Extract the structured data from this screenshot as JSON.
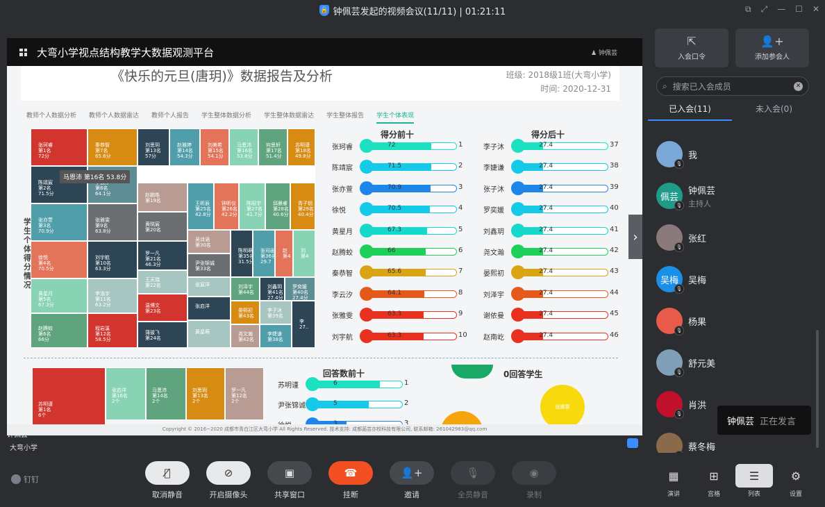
{
  "window": {
    "title": "钟佩芸发起的视频会议(11/11) | 01:21:11"
  },
  "share": {
    "platform_title": "大弯小学视点结构教学大数据观测平台",
    "user": "钟佩芸",
    "report_title": "《快乐的元旦(唐玥)》数据报告及分析",
    "class_info": "班级: 2018级1班(大弯小学)",
    "time_info": "时间: 2020-12-31",
    "tabs": [
      "教师个人数据分析",
      "教师个人数据雷达",
      "教师个人报告",
      "学生整体数据分析",
      "学生整体数据雷达",
      "学生整体报告",
      "学生个体表现"
    ],
    "vertical_label": "学生个体得分情况",
    "tooltip": "马恩沛 第16名 53.8分",
    "treemap_cells": [
      {
        "text": "张珂睿\n第1名\n72分",
        "color": "#d2352e"
      },
      {
        "text": "秦恭智\n第7名\n65.6分",
        "color": "#d78b12"
      },
      {
        "text": "刘思玥\n第13名\n57分",
        "color": "#2d4554"
      },
      {
        "text": "赵雅婷\n第14名\n54.3分",
        "color": "#4f9eaa"
      },
      {
        "text": "刘美希\n第15名\n54.1分",
        "color": "#e3745a"
      },
      {
        "text": "马恩沛\n第16名\n53.8分",
        "color": "#87d3b4"
      },
      {
        "text": "何思轩\n第17名\n51.4分",
        "color": "#5fa47f"
      },
      {
        "text": "苏明谨\n第18名\n49.8分",
        "color": "#d78b12"
      },
      {
        "text": "陈靖宸\n第2名\n71.5分",
        "color": "#2d4554"
      },
      {
        "text": "李云汐\n第8名\n64.1分",
        "color": "#5f8d95"
      },
      {
        "text": "张亦萱\n第3名\n70.9分",
        "color": "#4f9eaa"
      },
      {
        "text": "张雅雯\n第9名\n63.8分",
        "color": "#6b6f72"
      },
      {
        "text": "徐悦\n第4名\n70.5分",
        "color": "#e3745a"
      },
      {
        "text": "刘宇航\n第10名\n63.3分",
        "color": "#2d4554"
      },
      {
        "text": "黄星月\n第5名\n67.3分",
        "color": "#87d3b4"
      },
      {
        "text": "李浩宇\n第11名\n63.2分",
        "color": "#a8c6c1"
      },
      {
        "text": "赵腾蛟\n第6名\n66分",
        "color": "#5fa47f"
      },
      {
        "text": "程岩溪\n第12名\n58.5分",
        "color": "#d2352e"
      },
      {
        "text": "赵鹏皓\n第19名",
        "color": "#b89b93"
      },
      {
        "text": "黄晓宸\n第20名",
        "color": "#6b6f72"
      },
      {
        "text": "罗一凡\n第21名\n46.3分",
        "color": "#2d4554"
      },
      {
        "text": "王天瑞\n第22名",
        "color": "#a8c6c1"
      },
      {
        "text": "温博文\n第23名",
        "color": "#d2352e"
      },
      {
        "text": "蒲骏飞\n第24名",
        "color": "#2d4554"
      },
      {
        "text": "王昕辰\n第25名\n42.8分",
        "color": "#4f9eaa"
      },
      {
        "text": "钟昕仪\n第26名\n42.2分",
        "color": "#e3745a"
      },
      {
        "text": "陈昭宇\n第27名\n41.7分",
        "color": "#87d3b4"
      },
      {
        "text": "邱晨睿\n第28名\n40.6分",
        "color": "#5fa47f"
      },
      {
        "text": "青子钥\n第29名\n40.4分",
        "color": "#d78b12"
      },
      {
        "text": "吴诗涵\n第30名",
        "color": "#b89b93"
      },
      {
        "text": "尹张锦诚\n第33名",
        "color": "#6b6f72"
      },
      {
        "text": "陈明萌\n第35名\n31.5分",
        "color": "#2d4554"
      },
      {
        "text": "张司画\n第36名\n29.7",
        "color": "#4f9eaa"
      },
      {
        "text": "赵\n第4",
        "color": "#e3745a"
      },
      {
        "text": "刘\n第4",
        "color": "#87d3b4"
      },
      {
        "text": "张宸洋",
        "color": "#a8c6c1"
      },
      {
        "text": "张启洋",
        "color": "#2d4554"
      },
      {
        "text": "刘泽宇\n第44名",
        "color": "#5fa47f"
      },
      {
        "text": "刘鑫玥\n第41名\n27.4分",
        "color": "#2d4554"
      },
      {
        "text": "罗奕媛\n第40名\n27.4分",
        "color": "#5f8d95"
      },
      {
        "text": "黄星萌",
        "color": "#a8c6c1"
      },
      {
        "text": "晏熙初\n第43名",
        "color": "#d78b12"
      },
      {
        "text": "李子沐\n第39名",
        "color": "#a8c6c1"
      },
      {
        "text": "廖家麒\n第34名",
        "color": "#d2352e"
      },
      {
        "text": "尧文瀚\n第42名",
        "color": "#b89b93"
      },
      {
        "text": "李婕谦\n第38名",
        "color": "#4f9eaa"
      },
      {
        "text": "李\n27..",
        "color": "#2d4554"
      }
    ],
    "top_title": "得分前十",
    "bottom_title": "得分后十",
    "top_ten": [
      {
        "name": "张珂睿",
        "value": 72,
        "idx": "1",
        "color": "#1be1c0"
      },
      {
        "name": "陈靖宸",
        "value": 71.5,
        "idx": "2",
        "color": "#15c9e8"
      },
      {
        "name": "张亦萱",
        "value": 70.9,
        "idx": "3",
        "color": "#1e86e8"
      },
      {
        "name": "徐悦",
        "value": 70.5,
        "idx": "4",
        "color": "#15c9e8"
      },
      {
        "name": "黄星月",
        "value": 67.3,
        "idx": "5",
        "color": "#14d9cc"
      },
      {
        "name": "赵腾蛟",
        "value": 66,
        "idx": "6",
        "color": "#1ed05a"
      },
      {
        "name": "秦恭智",
        "value": 65.6,
        "idx": "7",
        "color": "#d9a512"
      },
      {
        "name": "李云汐",
        "value": 64.1,
        "idx": "8",
        "color": "#e55a1b"
      },
      {
        "name": "张雅雯",
        "value": 63.3,
        "idx": "9",
        "color": "#e8311e"
      },
      {
        "name": "刘宇航",
        "value": 63.3,
        "idx": "10",
        "color": "#e8311e"
      }
    ],
    "bottom_ten": [
      {
        "name": "李子沐",
        "value": 27.4,
        "idx": "37",
        "color": "#1be1c0"
      },
      {
        "name": "李婕谦",
        "value": 27.4,
        "idx": "38",
        "color": "#15c9e8"
      },
      {
        "name": "张子沐",
        "value": 27.4,
        "idx": "39",
        "color": "#1e86e8"
      },
      {
        "name": "罗奕媛",
        "value": 27.4,
        "idx": "40",
        "color": "#15c9e8"
      },
      {
        "name": "刘鑫玥",
        "value": 27.4,
        "idx": "41",
        "color": "#14d9cc"
      },
      {
        "name": "尧文瀚",
        "value": 27.4,
        "idx": "42",
        "color": "#1ed05a"
      },
      {
        "name": "晏熙初",
        "value": 27.4,
        "idx": "43",
        "color": "#d9a512"
      },
      {
        "name": "刘泽宇",
        "value": 27.4,
        "idx": "44",
        "color": "#e55a1b"
      },
      {
        "name": "谢依曼",
        "value": 27.4,
        "idx": "45",
        "color": "#e8311e"
      },
      {
        "name": "赵南屹",
        "value": 27.4,
        "idx": "46",
        "color": "#e8311e"
      }
    ],
    "answers_title": "回答数前十",
    "answers": [
      {
        "name": "苏明谨",
        "value": 6,
        "idx": "1",
        "color": "#1be1c0"
      },
      {
        "name": "尹张锦诚",
        "value": 5,
        "idx": "2",
        "color": "#15c9e8"
      },
      {
        "name": "徐悦",
        "value": 3,
        "idx": "3",
        "color": "#1e86e8"
      }
    ],
    "zero_title": "0回答学生",
    "zero_bubble": "张雅雯",
    "answer_cells": [
      {
        "text": "苏明谨\n第1名\n6个",
        "color": "#d2352e"
      },
      {
        "text": "张启洋\n第16名\n2个",
        "color": "#87d3b4"
      },
      {
        "text": "马恩沛\n第14名\n2个",
        "color": "#5fa47f"
      },
      {
        "text": "刘思玥\n第13名\n2个",
        "color": "#d78b12"
      },
      {
        "text": "罗一凡\n第12名\n2个",
        "color": "#b89b93"
      }
    ],
    "footer": "Copyright © 2016~2020 成都市青白江区大弯小学 All Rights Reserved. 技术支持: 成都菡芸亦校科技有限公司, 联系邮箱: 261042983@qq.com",
    "presenter": "钟佩芸",
    "school": "大弯小学"
  },
  "sidebar": {
    "invite_code": "入会口令",
    "add_participant": "添加参会人",
    "search_placeholder": "搜索已入会成员",
    "tab_joined": "已入会(11)",
    "tab_not_joined": "未入会(0)",
    "participants": [
      {
        "name": "我",
        "sub": "",
        "avatar": "photo",
        "color": "#7aa8d8"
      },
      {
        "name": "钟佩芸",
        "sub": "主持人",
        "avatar": "佩芸",
        "color": "#1f9b8a"
      },
      {
        "name": "张红",
        "sub": "",
        "avatar": "photo",
        "color": "#8a7a7c"
      },
      {
        "name": "吴梅",
        "sub": "",
        "avatar": "吴梅",
        "color": "#1a8fe8"
      },
      {
        "name": "杨果",
        "sub": "",
        "avatar": "photo",
        "color": "#e85a4a"
      },
      {
        "name": "舒元美",
        "sub": "",
        "avatar": "photo",
        "color": "#7fa0b8"
      },
      {
        "name": "肖洪",
        "sub": "",
        "avatar": "photo",
        "color": "#c0102a"
      },
      {
        "name": "蔡冬梅",
        "sub": "",
        "avatar": "photo",
        "color": "#8a6a4a"
      }
    ],
    "speaking_name": "钟佩芸",
    "speaking_status": "正在发言"
  },
  "toolbar": {
    "brand": "钉钉",
    "unmute": "取消静音",
    "camera": "开启摄像头",
    "share": "共享窗口",
    "hangup": "挂断",
    "invite": "邀请",
    "mute_all": "全员静音",
    "record": "录制",
    "layout_speaker": "演讲",
    "layout_grid": "宫格",
    "layout_list": "列表",
    "settings": "设置"
  }
}
